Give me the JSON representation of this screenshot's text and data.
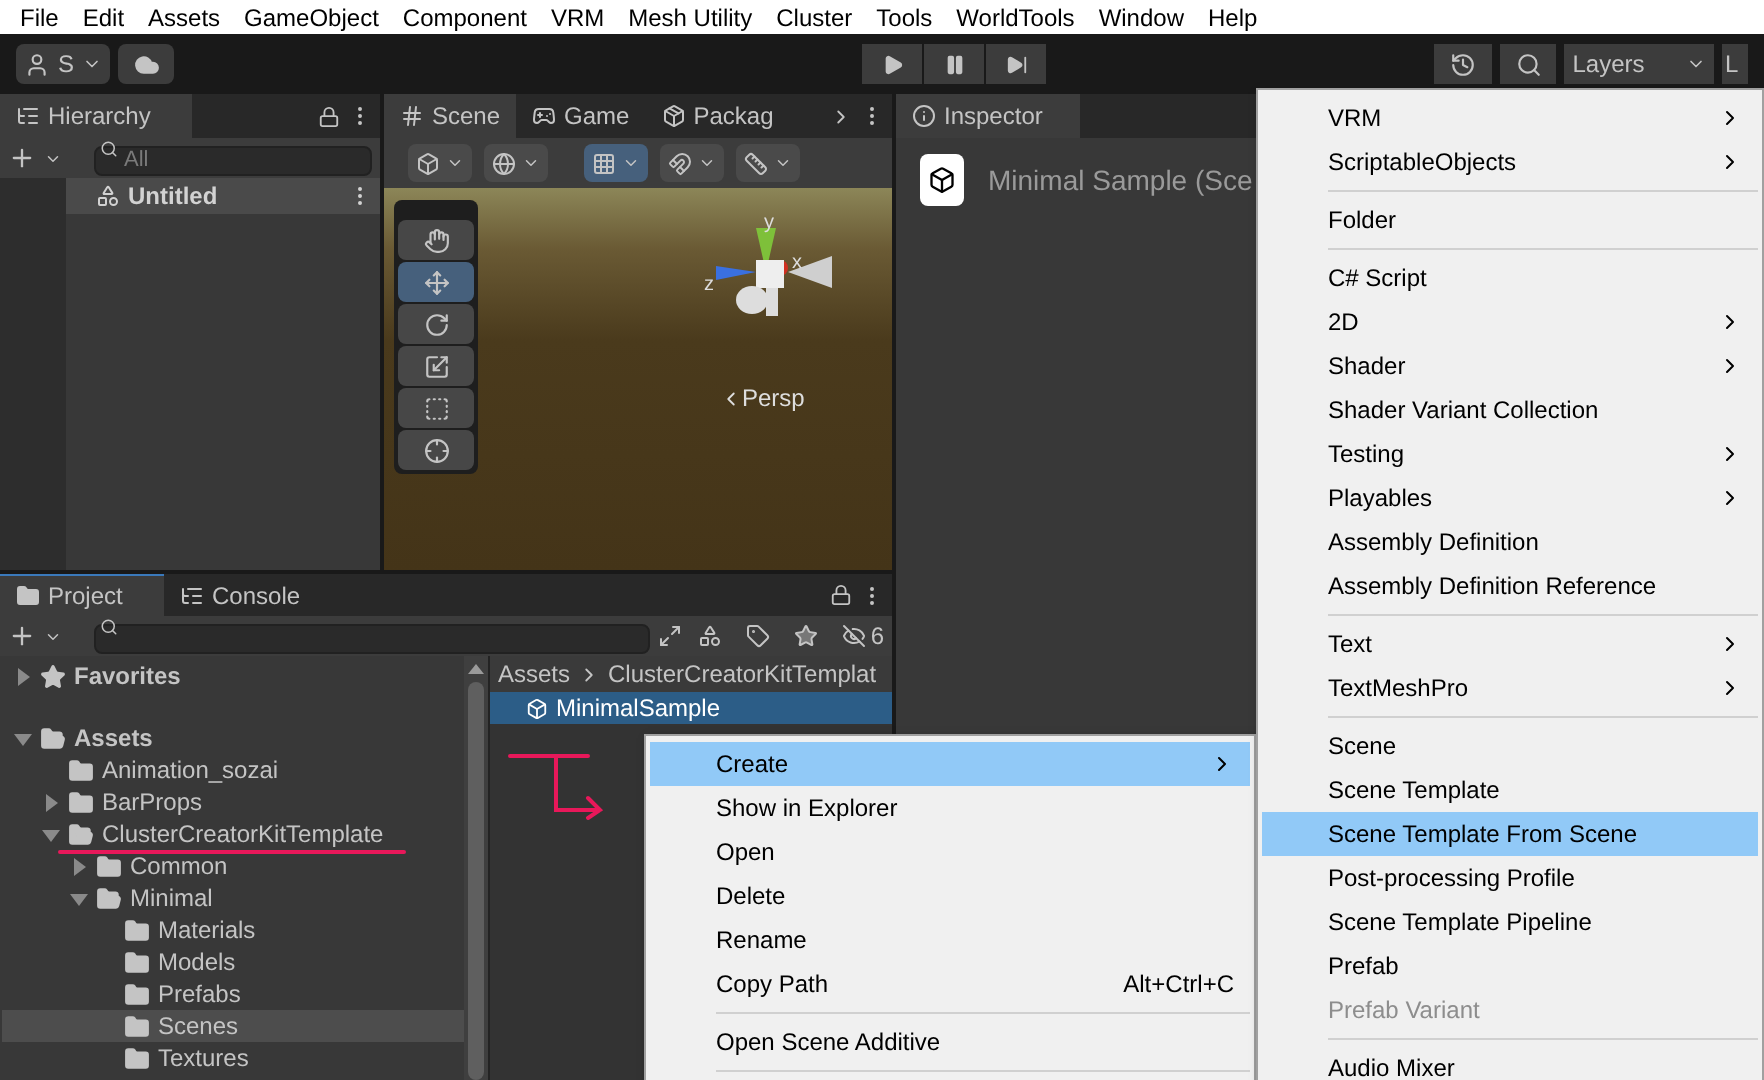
{
  "menubar": [
    {
      "label": "File"
    },
    {
      "label": "Edit"
    },
    {
      "label": "Assets"
    },
    {
      "label": "GameObject"
    },
    {
      "label": "Component"
    },
    {
      "label": "VRM"
    },
    {
      "label": "Mesh Utility"
    },
    {
      "label": "Cluster"
    },
    {
      "label": "Tools"
    },
    {
      "label": "WorldTools"
    },
    {
      "label": "Window"
    },
    {
      "label": "Help"
    }
  ],
  "toolbar": {
    "account": "S",
    "layers": "Layers",
    "layout": "L"
  },
  "hierarchy": {
    "title": "Hierarchy",
    "search_placeholder": "All",
    "scene": "Untitled"
  },
  "scene_tabs": [
    {
      "label": "Scene",
      "selected": true
    },
    {
      "label": "Game",
      "selected": false
    },
    {
      "label": "Packag",
      "selected": false
    }
  ],
  "scene_toolbar": [
    {
      "kind": "draw-mode",
      "on": false
    },
    {
      "kind": "globe",
      "on": false
    },
    {
      "kind": "grid",
      "on": true
    },
    {
      "kind": "snap",
      "on": false
    },
    {
      "kind": "ruler",
      "on": false
    }
  ],
  "tools": [
    {
      "kind": "hand",
      "selected": false
    },
    {
      "kind": "move",
      "selected": true
    },
    {
      "kind": "rotate",
      "selected": false
    },
    {
      "kind": "scale",
      "selected": false
    },
    {
      "kind": "rect",
      "selected": false
    },
    {
      "kind": "transform",
      "selected": false
    }
  ],
  "gizmo_labels": [
    "y",
    "x",
    "z"
  ],
  "projection": "Persp",
  "inspector": {
    "title": "Inspector",
    "asset": "Minimal Sample (Sce"
  },
  "project": {
    "tabs": [
      {
        "label": "Project",
        "selected": true
      },
      {
        "label": "Console",
        "selected": false
      }
    ],
    "hidden_count": "6",
    "tree": [
      {
        "label": "Favorites",
        "kind": "favorites",
        "expanded": false,
        "selected": false
      },
      {
        "label": "Assets",
        "kind": "folder",
        "expanded": true,
        "selected": false,
        "children": [
          {
            "label": "Animation_sozai",
            "kind": "folder",
            "selected": false
          },
          {
            "label": "BarProps",
            "kind": "folder",
            "expanded": false,
            "selected": false
          },
          {
            "label": "ClusterCreatorKitTemplate",
            "kind": "folder",
            "expanded": true,
            "selected": false,
            "children": [
              {
                "label": "Common",
                "kind": "folder",
                "expanded": false,
                "selected": false
              },
              {
                "label": "Minimal",
                "kind": "folder",
                "expanded": true,
                "selected": false,
                "children": [
                  {
                    "label": "Materials",
                    "kind": "folder",
                    "selected": false
                  },
                  {
                    "label": "Models",
                    "kind": "folder",
                    "selected": false
                  },
                  {
                    "label": "Prefabs",
                    "kind": "folder",
                    "selected": false
                  },
                  {
                    "label": "Scenes",
                    "kind": "folder",
                    "selected": true
                  },
                  {
                    "label": "Textures",
                    "kind": "folder",
                    "selected": false
                  }
                ]
              }
            ]
          }
        ]
      }
    ],
    "breadcrumb": [
      "Assets",
      "ClusterCreatorKitTemplat"
    ],
    "items": [
      {
        "label": "MinimalSample",
        "selected": true
      }
    ]
  },
  "context_menu": [
    {
      "kind": "item",
      "label": "Create",
      "submenu": true,
      "selected": true
    },
    {
      "kind": "item",
      "label": "Show in Explorer",
      "selected": false
    },
    {
      "kind": "item",
      "label": "Open",
      "selected": false
    },
    {
      "kind": "item",
      "label": "Delete",
      "selected": false
    },
    {
      "kind": "item",
      "label": "Rename",
      "selected": false
    },
    {
      "kind": "item",
      "label": "Copy Path",
      "shortcut": "Alt+Ctrl+C",
      "selected": false
    },
    {
      "kind": "separator"
    },
    {
      "kind": "item",
      "label": "Open Scene Additive",
      "selected": false
    },
    {
      "kind": "separator"
    }
  ],
  "create_submenu": [
    {
      "kind": "item",
      "label": "VRM",
      "submenu": true,
      "selected": false
    },
    {
      "kind": "item",
      "label": "ScriptableObjects",
      "submenu": true,
      "selected": false
    },
    {
      "kind": "separator"
    },
    {
      "kind": "item",
      "label": "Folder",
      "selected": false
    },
    {
      "kind": "separator"
    },
    {
      "kind": "item",
      "label": "C# Script",
      "selected": false
    },
    {
      "kind": "item",
      "label": "2D",
      "submenu": true,
      "selected": false
    },
    {
      "kind": "item",
      "label": "Shader",
      "submenu": true,
      "selected": false
    },
    {
      "kind": "item",
      "label": "Shader Variant Collection",
      "selected": false
    },
    {
      "kind": "item",
      "label": "Testing",
      "submenu": true,
      "selected": false
    },
    {
      "kind": "item",
      "label": "Playables",
      "submenu": true,
      "selected": false
    },
    {
      "kind": "item",
      "label": "Assembly Definition",
      "selected": false
    },
    {
      "kind": "item",
      "label": "Assembly Definition Reference",
      "selected": false
    },
    {
      "kind": "separator"
    },
    {
      "kind": "item",
      "label": "Text",
      "submenu": true,
      "selected": false
    },
    {
      "kind": "item",
      "label": "TextMeshPro",
      "submenu": true,
      "selected": false
    },
    {
      "kind": "separator"
    },
    {
      "kind": "item",
      "label": "Scene",
      "selected": false
    },
    {
      "kind": "item",
      "label": "Scene Template",
      "selected": false
    },
    {
      "kind": "item",
      "label": "Scene Template From Scene",
      "selected": true
    },
    {
      "kind": "item",
      "label": "Post-processing Profile",
      "selected": false
    },
    {
      "kind": "item",
      "label": "Scene Template Pipeline",
      "selected": false
    },
    {
      "kind": "item",
      "label": "Prefab",
      "selected": false
    },
    {
      "kind": "item",
      "label": "Prefab Variant",
      "disabled": true,
      "selected": false
    },
    {
      "kind": "separator"
    },
    {
      "kind": "item",
      "label": "Audio Mixer",
      "selected": false
    }
  ]
}
